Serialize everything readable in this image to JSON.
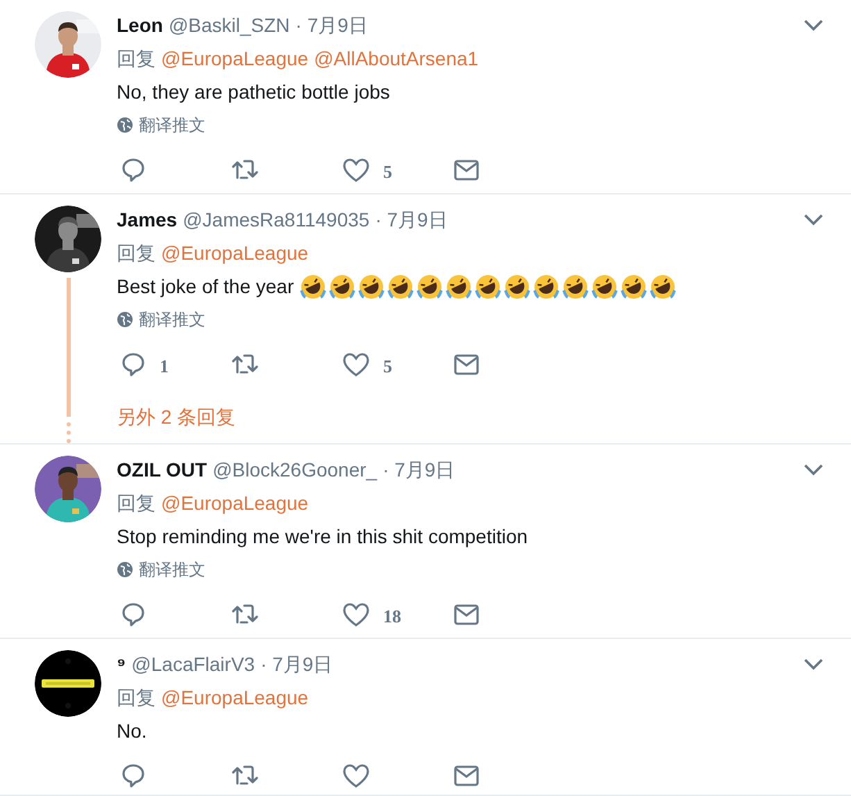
{
  "tweets": [
    {
      "avatar": {
        "kind": "picture"
      },
      "name": "Leon",
      "handle": "@Baskil_SZN",
      "date": "· 7月9日",
      "reply_label": "回复",
      "mentions": [
        "@EuropaLeague",
        "@AllAboutArsena1"
      ],
      "text": "No, they are pathetic bottle jobs",
      "translate": "翻译推文",
      "like_count": "5"
    },
    {
      "avatar": {
        "kind": "picture"
      },
      "name": "James",
      "handle": "@JamesRa81149035",
      "date": "· 7月9日",
      "reply_label": "回复",
      "mentions": [
        "@EuropaLeague"
      ],
      "text": "Best joke of the year",
      "reactions": [
        {
          "kind": "rofl"
        },
        {
          "kind": "rofl"
        },
        {
          "kind": "rofl"
        },
        {
          "kind": "rofl"
        },
        {
          "kind": "rofl"
        },
        {
          "kind": "rofl"
        },
        {
          "kind": "rofl"
        },
        {
          "kind": "rofl"
        },
        {
          "kind": "rofl"
        },
        {
          "kind": "rofl"
        },
        {
          "kind": "rofl"
        },
        {
          "kind": "rofl"
        },
        {
          "kind": "rofl"
        }
      ],
      "translate": "翻译推文",
      "reply_count": "1",
      "like_count": "5",
      "more_replies": "另外 2 条回复"
    },
    {
      "avatar": {
        "kind": "picture"
      },
      "name": "OZIL OUT",
      "handle": "@Block26Gooner_",
      "date": "· 7月9日",
      "reply_label": "回复",
      "mentions": [
        "@EuropaLeague"
      ],
      "text": "Stop reminding me we're in this shit competition",
      "translate": "翻译推文",
      "like_count": "18"
    },
    {
      "avatar": {
        "kind": "picture"
      },
      "name": "⁹",
      "handle": "@LacaFlairV3",
      "date": "· 7月9日",
      "reply_label": "回复",
      "mentions": [
        "@EuropaLeague"
      ],
      "text": "No."
    }
  ]
}
